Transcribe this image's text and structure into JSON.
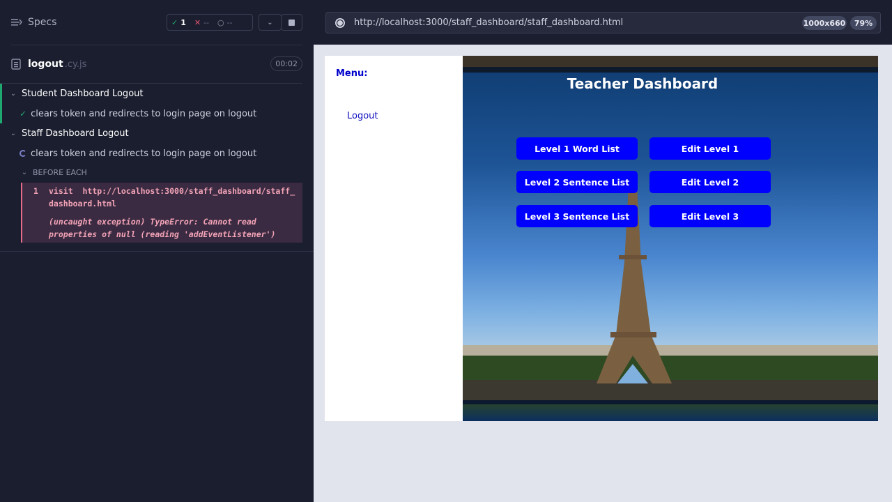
{
  "runner": {
    "specs_label": "Specs",
    "stats": {
      "passed": "1",
      "failed": "--",
      "pending": "--"
    },
    "file": {
      "name": "logout",
      "ext": ".cy.js",
      "duration": "00:02"
    },
    "suites": [
      {
        "title": "Student Dashboard Logout",
        "test": "clears token and redirects to login page on logout",
        "status": "passed"
      },
      {
        "title": "Staff Dashboard Logout",
        "test": "clears token and redirects to login page on logout",
        "status": "running"
      }
    ],
    "hook_label": "BEFORE EACH",
    "command": {
      "index": "1",
      "name": "visit",
      "url_line1": "http://localhost:3000/staff_dashboard/staff_",
      "url_line2": "dashboard.html",
      "error_line1": "(uncaught exception)  TypeError: Cannot read",
      "error_line2": "properties of null (reading 'addEventListener')"
    },
    "colors": {
      "passed": "#1fa971",
      "failed": "#e45770",
      "accent": "#0000ff"
    }
  },
  "browser": {
    "url": "http://localhost:3000/staff_dashboard/staff_dashboard.html",
    "viewport": "1000x660",
    "zoom": "79%"
  },
  "app": {
    "menu_title": "Menu:",
    "logout_link": "Logout",
    "dashboard_title": "Teacher Dashboard",
    "buttons": [
      "Level 1 Word List",
      "Edit Level 1",
      "Level 2 Sentence List",
      "Edit Level 2",
      "Level 3 Sentence List",
      "Edit Level 3"
    ]
  }
}
